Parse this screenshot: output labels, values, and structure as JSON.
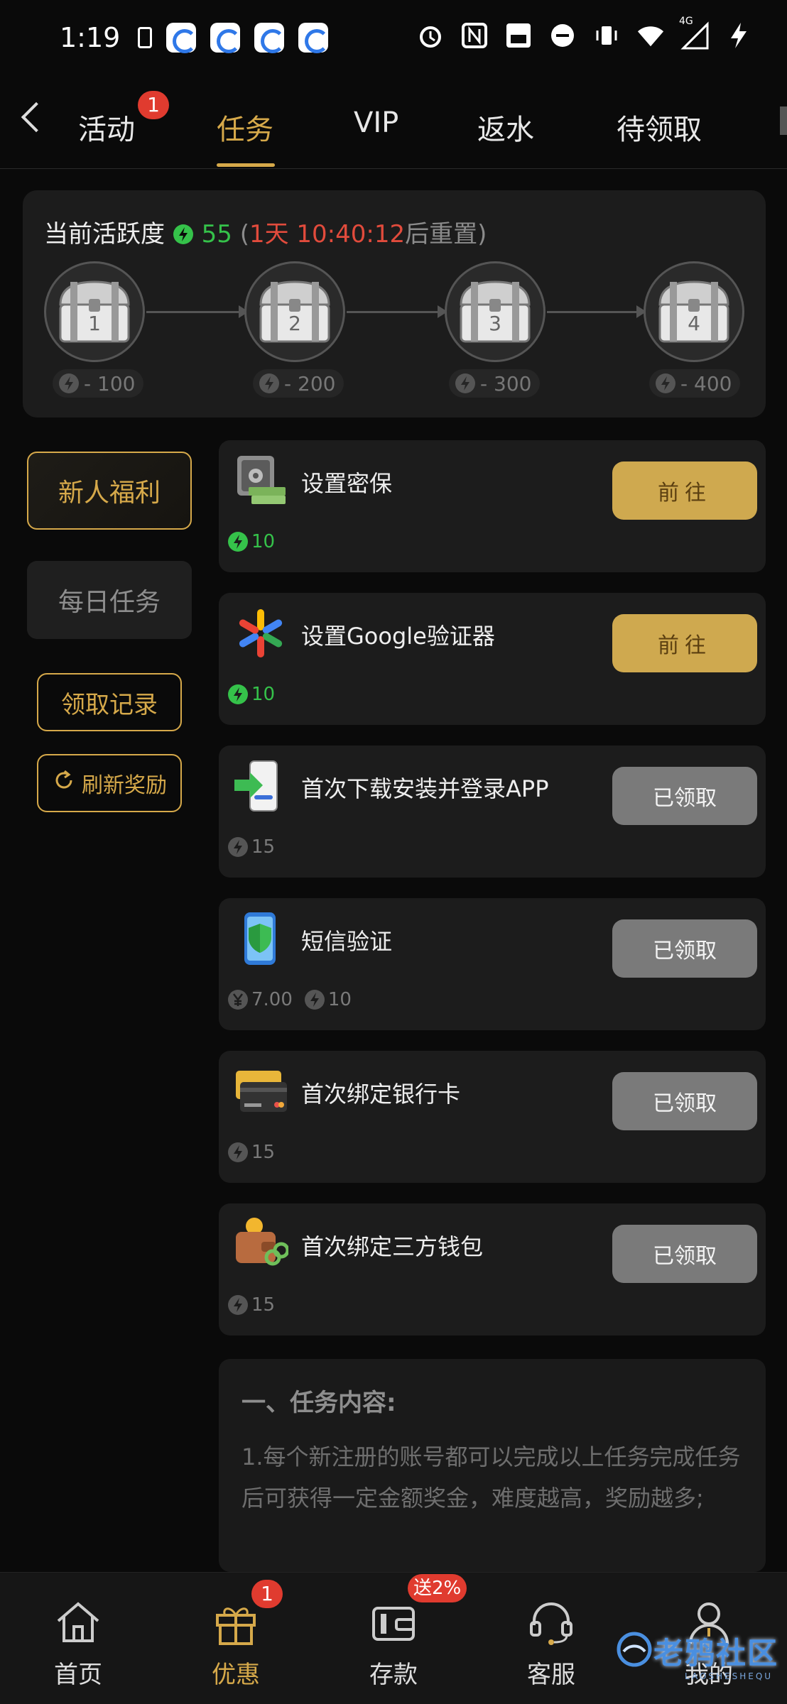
{
  "status_bar": {
    "time": "1:19",
    "signal_label": "4G"
  },
  "tabs": [
    {
      "label": "活动",
      "badge": "1"
    },
    {
      "label": "任务"
    },
    {
      "label": "VIP"
    },
    {
      "label": "返水"
    },
    {
      "label": "待领取"
    }
  ],
  "activity": {
    "title": "当前活跃度",
    "points": "55",
    "reset_open": "(",
    "reset_time": "1天 10:40:12",
    "reset_suffix": "后重置)",
    "chests": [
      {
        "num": "1",
        "req": "- 100"
      },
      {
        "num": "2",
        "req": "- 200"
      },
      {
        "num": "3",
        "req": "- 300"
      },
      {
        "num": "4",
        "req": "- 400"
      }
    ]
  },
  "side_menu": {
    "newcomer": "新人福利",
    "daily": "每日任务",
    "records": "领取记录",
    "refresh": "刷新奖励"
  },
  "tasks": [
    {
      "title": "设置密保",
      "rewards": [
        {
          "type": "bolt",
          "value": "10"
        }
      ],
      "button": "前往",
      "status": "go",
      "icon": "safe-icon"
    },
    {
      "title": "设置Google验证器",
      "rewards": [
        {
          "type": "bolt",
          "value": "10"
        }
      ],
      "button": "前往",
      "status": "go",
      "icon": "google-authenticator-icon"
    },
    {
      "title": "首次下载安装并登录APP",
      "rewards": [
        {
          "type": "bolt",
          "value": "15"
        }
      ],
      "button": "已领取",
      "status": "done",
      "icon": "phone-download-icon"
    },
    {
      "title": "短信验证",
      "rewards": [
        {
          "type": "yen",
          "value": "7.00"
        },
        {
          "type": "bolt",
          "value": "10"
        }
      ],
      "button": "已领取",
      "status": "done",
      "icon": "phone-shield-icon"
    },
    {
      "title": "首次绑定银行卡",
      "rewards": [
        {
          "type": "bolt",
          "value": "15"
        }
      ],
      "button": "已领取",
      "status": "done",
      "icon": "bank-card-icon"
    },
    {
      "title": "首次绑定三方钱包",
      "rewards": [
        {
          "type": "bolt",
          "value": "15"
        }
      ],
      "button": "已领取",
      "status": "done",
      "icon": "wallet-link-icon"
    }
  ],
  "description": {
    "heading": "一、任务内容:",
    "text": "1.每个新注册的账号都可以完成以上任务完成任务后可获得一定金额奖金，难度越高，奖励越多;"
  },
  "bottom_nav": [
    {
      "label": "首页",
      "icon": "home-icon"
    },
    {
      "label": "优惠",
      "icon": "gift-icon",
      "badge": "1"
    },
    {
      "label": "存款",
      "icon": "wallet-icon",
      "badge": "送2%"
    },
    {
      "label": "客服",
      "icon": "headset-icon"
    },
    {
      "label": "我的",
      "icon": "user-icon"
    }
  ],
  "watermark": {
    "text": "老鸦社区",
    "sub": "LAOSHESHEQU"
  },
  "colors": {
    "accent": "#d6a94a",
    "green": "#35c24a",
    "red": "#e14b3c",
    "badge": "#e03b2f"
  }
}
